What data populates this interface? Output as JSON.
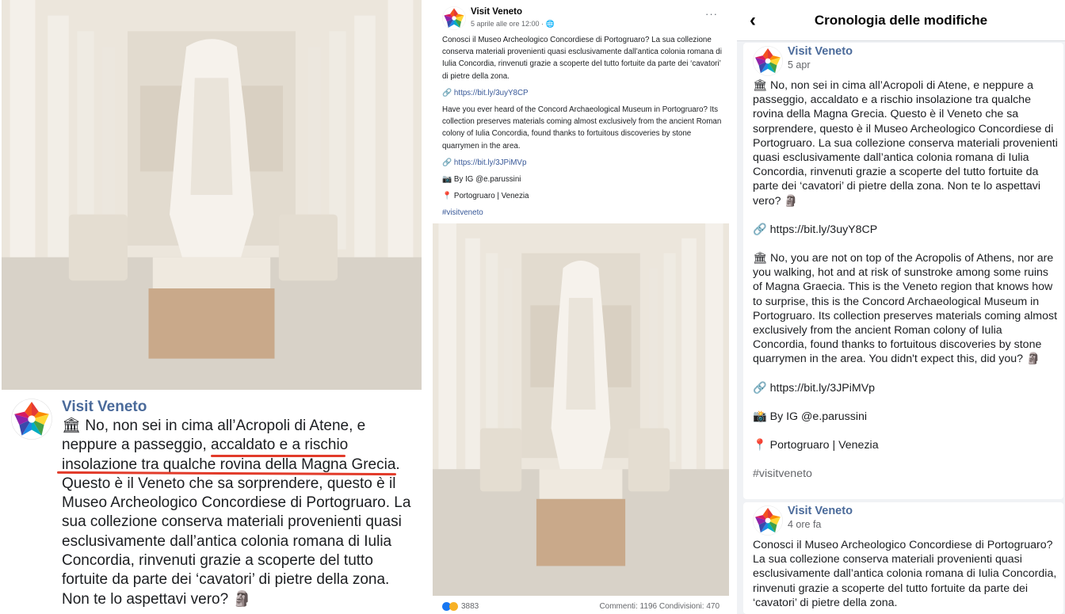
{
  "colors": {
    "page_name": "#4a6a9a",
    "underline": "#e23b2a",
    "link": "#385898",
    "history_bg": "#f0f2f5",
    "avatar_petals": [
      "#e53935",
      "#fb8c00",
      "#fdd835",
      "#43a047",
      "#1e88e5",
      "#8e24aa"
    ]
  },
  "left_post": {
    "page_name": "Visit Veneto",
    "icon": "classical-building-icon",
    "text": "🏛 No, non sei in cima all’Acropoli di Atene, e neppure a passeggio, accaldato e a rischio insolazione tra qualche rovina della Magna Grecia. Questo è il Veneto che sa sorprendere, questo è il Museo Archeologico Concordiese di Portogruaro. La sua collezione conserva materiali provenienti quasi esclusivamente dall’antica colonia romana di Iulia Concordia, rinvenuti grazie a scoperte del tutto fortuite da parte dei ‘cavatori’ di pietre della zona. Non te lo aspettavi vero? 🗿"
  },
  "middle_post": {
    "page_name": "Visit Veneto",
    "meta": "5 aprile alle ore 12:00 · 🌐",
    "more": "···",
    "paragraphs": [
      "Conosci il Museo Archeologico Concordiese di Portogruaro? La sua collezione conserva materiali provenienti quasi esclusivamente dall’antica colonia romana di Iulia Concordia, rinvenuti grazie a scoperte del tutto fortuite da parte dei ‘cavatori’ di pietre della zona.",
      "🔗 https://bit.ly/3uyY8CP",
      "Have you ever heard of the Concord Archaeological Museum in Portogruaro? Its collection preserves materials coming almost exclusively from the ancient Roman colony of Iulia Concordia, found thanks to fortuitous discoveries by stone quarrymen in the area.",
      "🔗 https://bit.ly/3JPiMVp",
      "📷 By IG @e.parussini",
      "📍 Portogruaro | Venezia",
      "#visitveneto"
    ],
    "reactions_count": "3883",
    "stats": "Commenti: 1196  Condivisioni: 470"
  },
  "history": {
    "title": "Cronologia delle modifiche",
    "back": "‹",
    "entries": [
      {
        "page_name": "Visit Veneto",
        "date": "5 apr",
        "paragraphs": [
          "🏛 No, non sei in cima all’Acropoli di Atene, e neppure a passeggio, accaldato e a rischio insolazione tra qualche rovina della Magna Grecia. Questo è il Veneto che sa sorprendere, questo è il Museo Archeologico Concordiese di Portogruaro. La sua collezione conserva materiali provenienti quasi esclusivamente dall’antica colonia romana di Iulia Concordia, rinvenuti grazie a scoperte del tutto fortuite da parte dei ‘cavatori’ di pietre della zona. Non te lo aspettavi vero? 🗿",
          "🔗 https://bit.ly/3uyY8CP",
          "🏛 No, you are not on top of the Acropolis of Athens, nor are you walking, hot and at risk of sunstroke among some ruins of Magna Graecia. This is the Veneto region that knows how to surprise, this is the Concord Archaeological Museum in Portogruaro. Its collection preserves materials coming almost exclusively from the ancient Roman colony of Iulia Concordia, found thanks to fortuitous discoveries by stone quarrymen in the area. You didn't expect this, did you? 🗿",
          "🔗 https://bit.ly/3JPiMVp",
          "📸 By IG @e.parussini",
          "📍 Portogruaro | Venezia",
          "#visitveneto"
        ]
      },
      {
        "page_name": "Visit Veneto",
        "date": "4 ore fa",
        "paragraphs": [
          "Conosci il Museo Archeologico Concordiese di Portogruaro? La sua collezione conserva materiali provenienti quasi esclusivamente dall’antica colonia romana di Iulia Concordia, rinvenuti grazie a scoperte del tutto fortuite da parte dei ‘cavatori’ di pietre della zona."
        ]
      }
    ]
  }
}
